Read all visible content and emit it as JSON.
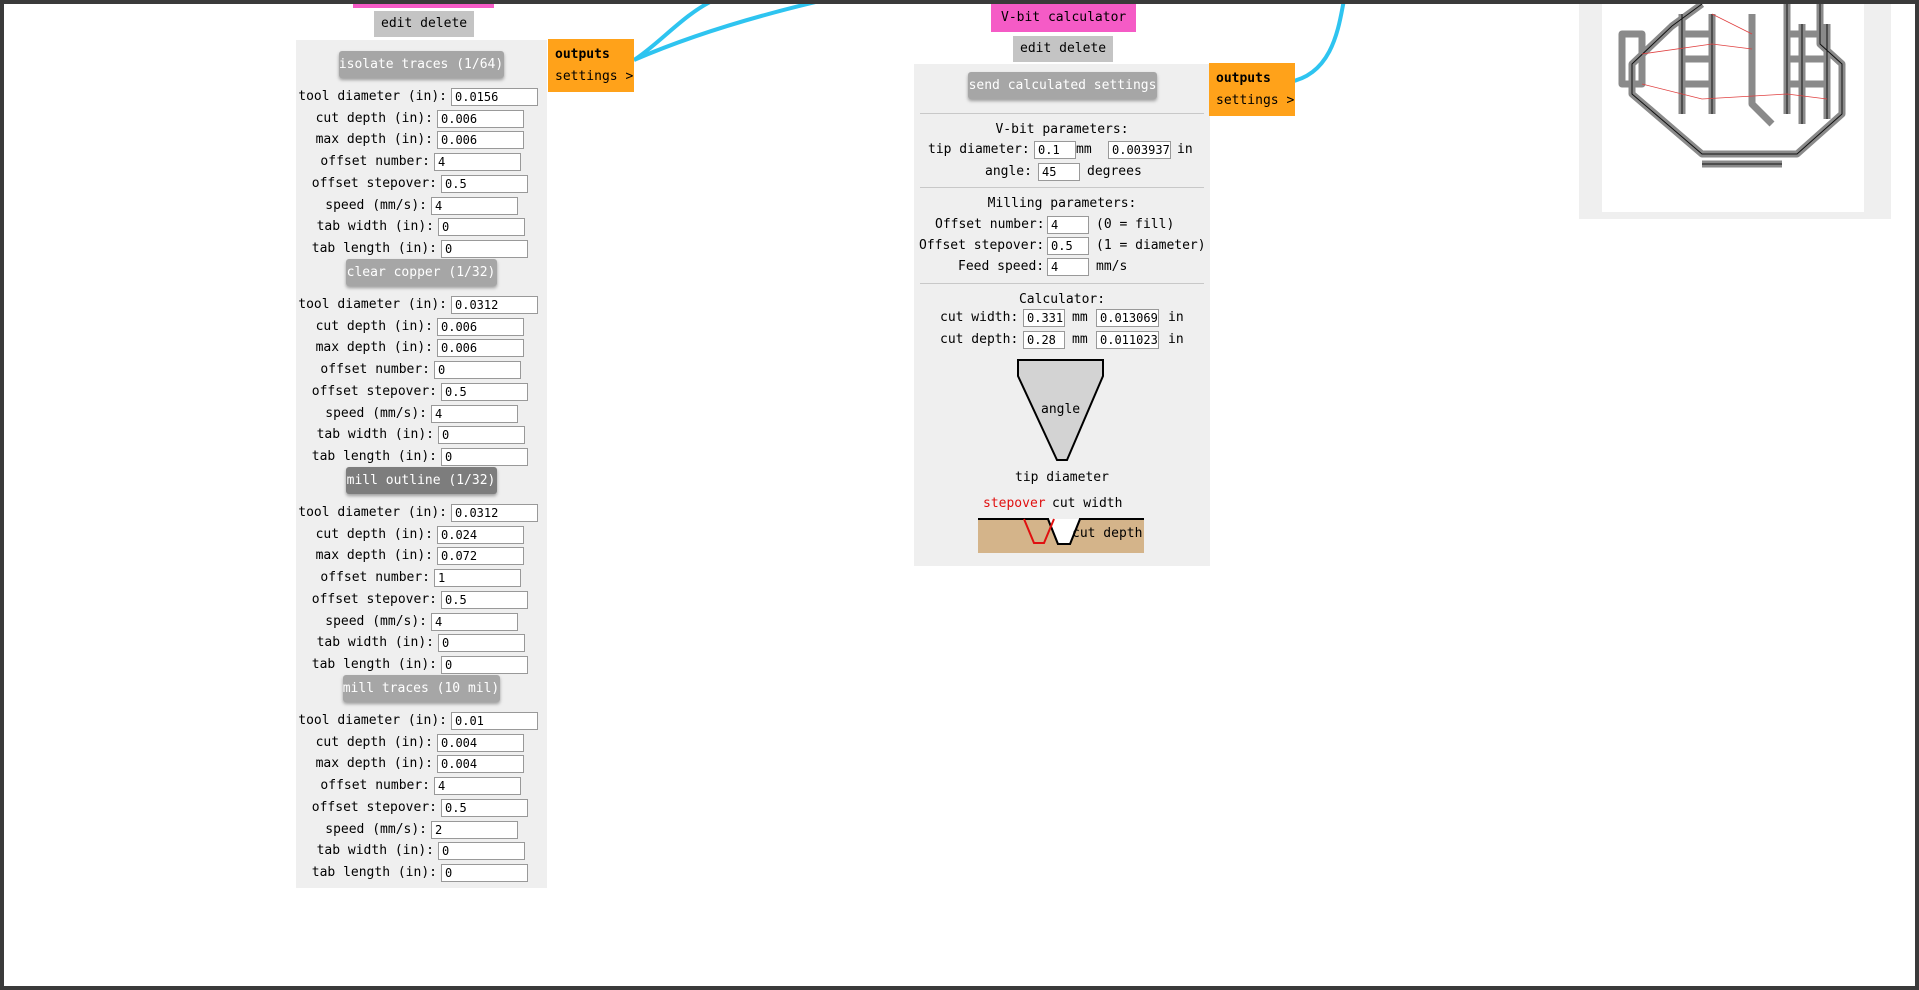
{
  "left_node": {
    "edit_label": "edit delete",
    "outputs": {
      "title": "outputs",
      "settings": "settings >"
    },
    "sections": [
      {
        "button": "isolate traces (1/64)",
        "style": "light",
        "fields": [
          {
            "label": "tool diameter (in):",
            "value": "0.0156"
          },
          {
            "label": "cut depth (in):",
            "value": "0.006"
          },
          {
            "label": "max depth (in):",
            "value": "0.006"
          },
          {
            "label": "offset number:",
            "value": "4"
          },
          {
            "label": "offset stepover:",
            "value": "0.5"
          },
          {
            "label": "speed (mm/s):",
            "value": "4"
          },
          {
            "label": "tab width (in):",
            "value": "0"
          },
          {
            "label": "tab length (in):",
            "value": "0"
          }
        ]
      },
      {
        "button": "clear copper (1/32)",
        "style": "light",
        "fields": [
          {
            "label": "tool diameter (in):",
            "value": "0.0312"
          },
          {
            "label": "cut depth (in):",
            "value": "0.006"
          },
          {
            "label": "max depth (in):",
            "value": "0.006"
          },
          {
            "label": "offset number:",
            "value": "0"
          },
          {
            "label": "offset stepover:",
            "value": "0.5"
          },
          {
            "label": "speed (mm/s):",
            "value": "4"
          },
          {
            "label": "tab width (in):",
            "value": "0"
          },
          {
            "label": "tab length (in):",
            "value": "0"
          }
        ]
      },
      {
        "button": "mill outline (1/32)",
        "style": "dark",
        "fields": [
          {
            "label": "tool diameter (in):",
            "value": "0.0312"
          },
          {
            "label": "cut depth (in):",
            "value": "0.024"
          },
          {
            "label": "max depth (in):",
            "value": "0.072"
          },
          {
            "label": "offset number:",
            "value": "1"
          },
          {
            "label": "offset stepover:",
            "value": "0.5"
          },
          {
            "label": "speed (mm/s):",
            "value": "4"
          },
          {
            "label": "tab width (in):",
            "value": "0"
          },
          {
            "label": "tab length (in):",
            "value": "0"
          }
        ]
      },
      {
        "button": "mill traces (10 mil)",
        "style": "light",
        "fields": [
          {
            "label": "tool diameter (in):",
            "value": "0.01"
          },
          {
            "label": "cut depth (in):",
            "value": "0.004"
          },
          {
            "label": "max depth (in):",
            "value": "0.004"
          },
          {
            "label": "offset number:",
            "value": "4"
          },
          {
            "label": "offset stepover:",
            "value": "0.5"
          },
          {
            "label": "speed (mm/s):",
            "value": "2"
          },
          {
            "label": "tab width (in):",
            "value": "0"
          },
          {
            "label": "tab length (in):",
            "value": "0"
          }
        ]
      }
    ]
  },
  "vbit_node": {
    "title": "V-bit calculator",
    "edit_label": "edit delete",
    "send_button": "send calculated settings",
    "outputs": {
      "title": "outputs",
      "settings": "settings >"
    },
    "vbit_params": {
      "heading": "V-bit parameters:",
      "tip_label": "tip diameter:",
      "tip_mm": "0.1",
      "mm_unit": "mm",
      "tip_in": "0.003937",
      "in_unit": "in",
      "angle_label": "angle:",
      "angle_value": "45",
      "angle_unit": "degrees"
    },
    "milling_params": {
      "heading": "Milling parameters:",
      "offset_label": "Offset number:",
      "offset_value": "4",
      "offset_note": "(0 = fill)",
      "stepover_label": "Offset stepover:",
      "stepover_value": "0.5",
      "stepover_note": "(1 = diameter)",
      "feed_label": "Feed speed:",
      "feed_value": "4",
      "feed_unit": "mm/s"
    },
    "calculator": {
      "heading": "Calculator:",
      "cut_width_label": "cut width:",
      "cut_width_mm": "0.331",
      "cut_width_in": "0.013069",
      "cut_depth_label": "cut depth:",
      "cut_depth_mm": "0.28",
      "cut_depth_in": "0.011023",
      "mm_unit": "mm",
      "in_unit": "in"
    },
    "diagram": {
      "angle_label": "angle",
      "tip_label": "tip diameter",
      "stepover_label": "stepover",
      "cut_width_label": "cut width",
      "cut_depth_label": "cut depth",
      "stepover_color": "#e01010"
    }
  },
  "colors": {
    "node_title": "#f55bc6",
    "outputs": "#ffa21a",
    "wire": "#2ec4f0",
    "panel": "#efefef",
    "copper": "#d4b48a"
  }
}
